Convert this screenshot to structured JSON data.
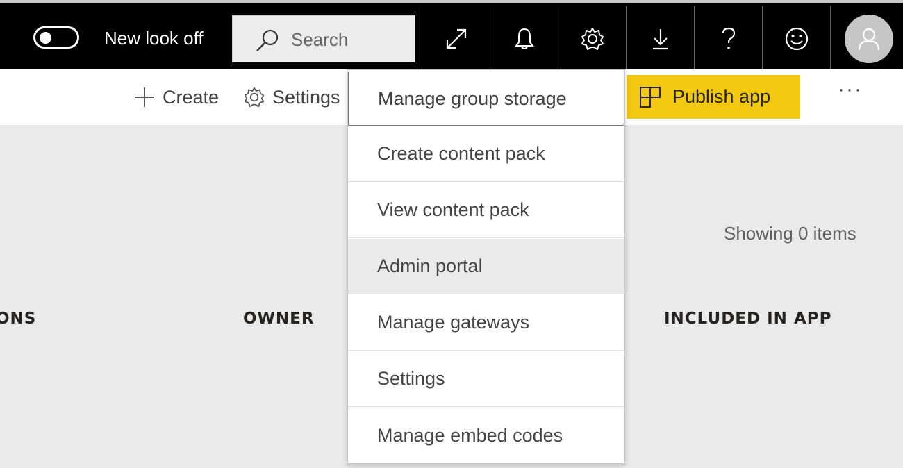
{
  "topbar": {
    "toggle_label": "New look off",
    "search_placeholder": "Search",
    "icons": [
      "expand-icon",
      "bell-icon",
      "gear-icon",
      "download-icon",
      "help-icon",
      "smiley-icon",
      "user-icon"
    ]
  },
  "actionbar": {
    "create_label": "Create",
    "settings_label": "Settings",
    "publish_label": "Publish app",
    "more_label": "···"
  },
  "main": {
    "showing_label": "Showing 0 items",
    "columns": [
      "ONS",
      "OWNER",
      "INCLUDED IN APP"
    ]
  },
  "menu": {
    "items": [
      "Manage group storage",
      "Create content pack",
      "View content pack",
      "Admin portal",
      "Manage gateways",
      "Settings",
      "Manage embed codes"
    ]
  },
  "colors": {
    "topbar_bg": "#000000",
    "accent_yellow": "#f2c811",
    "content_bg": "#eaeaea"
  }
}
